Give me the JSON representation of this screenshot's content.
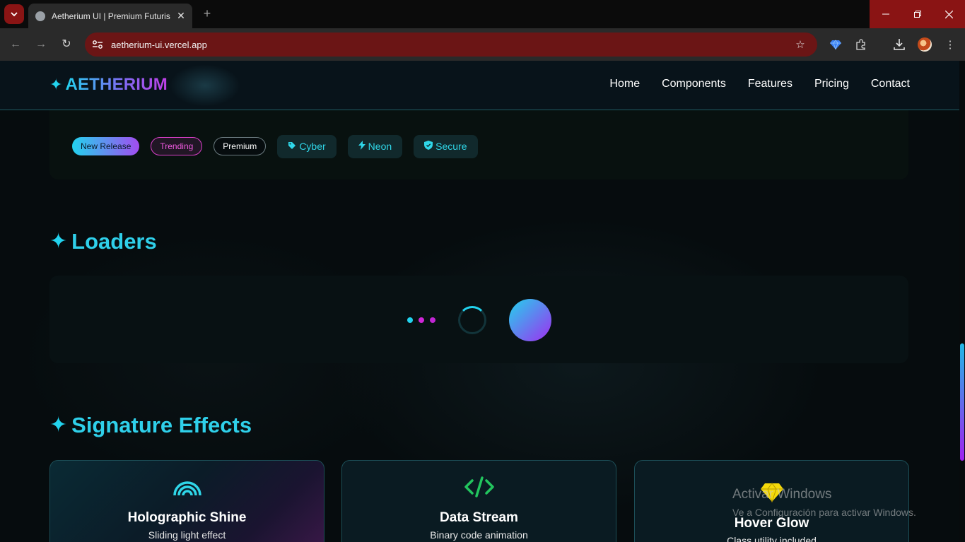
{
  "browser": {
    "tab_title": "Aetherium UI | Premium Futuris",
    "url": "aetherium-ui.vercel.app",
    "accent_color": "#8a1414",
    "icons": [
      "tab-search-icon",
      "globe-favicon-icon",
      "close-icon",
      "new-tab-icon",
      "back-icon",
      "forward-icon",
      "reload-icon",
      "site-settings-icon",
      "bookmark-star-icon",
      "gem-extension-icon",
      "extensions-icon",
      "download-icon",
      "profile-avatar",
      "more-menu-icon",
      "minimize-icon",
      "restore-icon",
      "close-window-icon"
    ]
  },
  "site": {
    "logo": "AETHERIUM",
    "nav": [
      "Home",
      "Components",
      "Features",
      "Pricing",
      "Contact"
    ]
  },
  "badges": {
    "new_release": "New Release",
    "trending": "Trending",
    "premium": "Premium",
    "cyber": "Cyber",
    "neon": "Neon",
    "secure": "Secure"
  },
  "sections": {
    "loaders": "Loaders",
    "signature_effects": "Signature Effects"
  },
  "loaders": {
    "dot_colors": [
      "#22d3ee",
      "#d026d8",
      "#c026d3"
    ]
  },
  "cards": [
    {
      "title": "Holographic Shine",
      "subtitle": "Sliding light effect",
      "icon": "rainbow-arcs-icon"
    },
    {
      "title": "Data Stream",
      "subtitle": "Binary code animation",
      "icon": "code-brackets-icon"
    },
    {
      "title": "Hover Glow",
      "subtitle": "Class utility included",
      "icon": "sparkle-icon"
    }
  ],
  "watermark": {
    "title": "Activar Windows",
    "subtitle": "Ve a Configuración para activar Windows."
  }
}
